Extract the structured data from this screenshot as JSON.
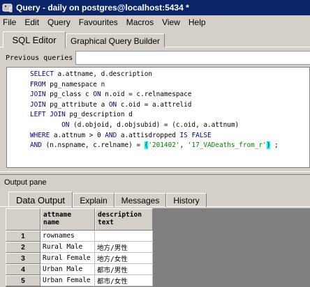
{
  "window": {
    "title": "Query - daily on postgres@localhost:5434 *",
    "icon": "pgadmin-elephant-icon"
  },
  "menu": [
    "File",
    "Edit",
    "Query",
    "Favourites",
    "Macros",
    "View",
    "Help"
  ],
  "tabs": {
    "sql_editor": "SQL Editor",
    "graphical_builder": "Graphical Query Builder"
  },
  "previous_queries": {
    "label": "Previous queries",
    "value": ""
  },
  "sql_lines": [
    [
      {
        "t": "SELECT",
        "c": "kw"
      },
      {
        "t": " a.attname, d.description",
        "c": "tok-plain"
      }
    ],
    [
      {
        "t": "FROM",
        "c": "kw"
      },
      {
        "t": " pg_namespace n",
        "c": "tok-plain"
      }
    ],
    [
      {
        "t": "JOIN",
        "c": "kw"
      },
      {
        "t": " pg_class c ",
        "c": "tok-plain"
      },
      {
        "t": "ON",
        "c": "kw"
      },
      {
        "t": " n.oid = c.relnamespace",
        "c": "tok-plain"
      }
    ],
    [
      {
        "t": "JOIN",
        "c": "kw"
      },
      {
        "t": " pg_attribute a ",
        "c": "tok-plain"
      },
      {
        "t": "ON",
        "c": "kw"
      },
      {
        "t": " c.oid = a.attrelid",
        "c": "tok-plain"
      }
    ],
    [
      {
        "t": "LEFT JOIN",
        "c": "kw"
      },
      {
        "t": " pg_description d",
        "c": "tok-plain"
      }
    ],
    [
      {
        "t": "        ON",
        "c": "kw"
      },
      {
        "t": " (d.objoid, d.objsubid) = (c.oid, a.attnum)",
        "c": "tok-plain"
      }
    ],
    [
      {
        "t": "WHERE",
        "c": "kw"
      },
      {
        "t": " a.attnum > ",
        "c": "tok-plain"
      },
      {
        "t": "0",
        "c": "num"
      },
      {
        "t": " ",
        "c": "tok-plain"
      },
      {
        "t": "AND",
        "c": "kw"
      },
      {
        "t": " a.attisdropped ",
        "c": "tok-plain"
      },
      {
        "t": "IS FALSE",
        "c": "kw"
      }
    ],
    [
      {
        "t": "AND",
        "c": "kw"
      },
      {
        "t": " (n.nspname, c.relname) = ",
        "c": "tok-plain"
      },
      {
        "t": "(",
        "c": "caret-hl"
      },
      {
        "t": "'201402'",
        "c": "str"
      },
      {
        "t": ", ",
        "c": "tok-plain"
      },
      {
        "t": "'17_VADeaths_from_r'",
        "c": "str"
      },
      {
        "t": ")",
        "c": "caret-hl"
      },
      {
        "t": " ;",
        "c": "tok-plain"
      }
    ]
  ],
  "output_pane": {
    "label": "Output pane",
    "tabs": [
      "Data Output",
      "Explain",
      "Messages",
      "History"
    ],
    "active_tab": "Data Output"
  },
  "grid": {
    "columns": [
      {
        "name": "attname",
        "type": "name"
      },
      {
        "name": "description",
        "type": "text"
      }
    ],
    "rows": [
      {
        "num": "1",
        "attname": "rownames",
        "description": ""
      },
      {
        "num": "2",
        "attname": "Rural Male",
        "description": "地方/男性"
      },
      {
        "num": "3",
        "attname": "Rural Female",
        "description": "地方/女性"
      },
      {
        "num": "4",
        "attname": "Urban Male",
        "description": "都市/男性"
      },
      {
        "num": "5",
        "attname": "Urban Female",
        "description": "都市/女性"
      }
    ]
  },
  "colors": {
    "titlebar": "#0a246a",
    "keyword": "#00008b",
    "string": "#008000",
    "bracket_highlight": "#00ffff"
  }
}
